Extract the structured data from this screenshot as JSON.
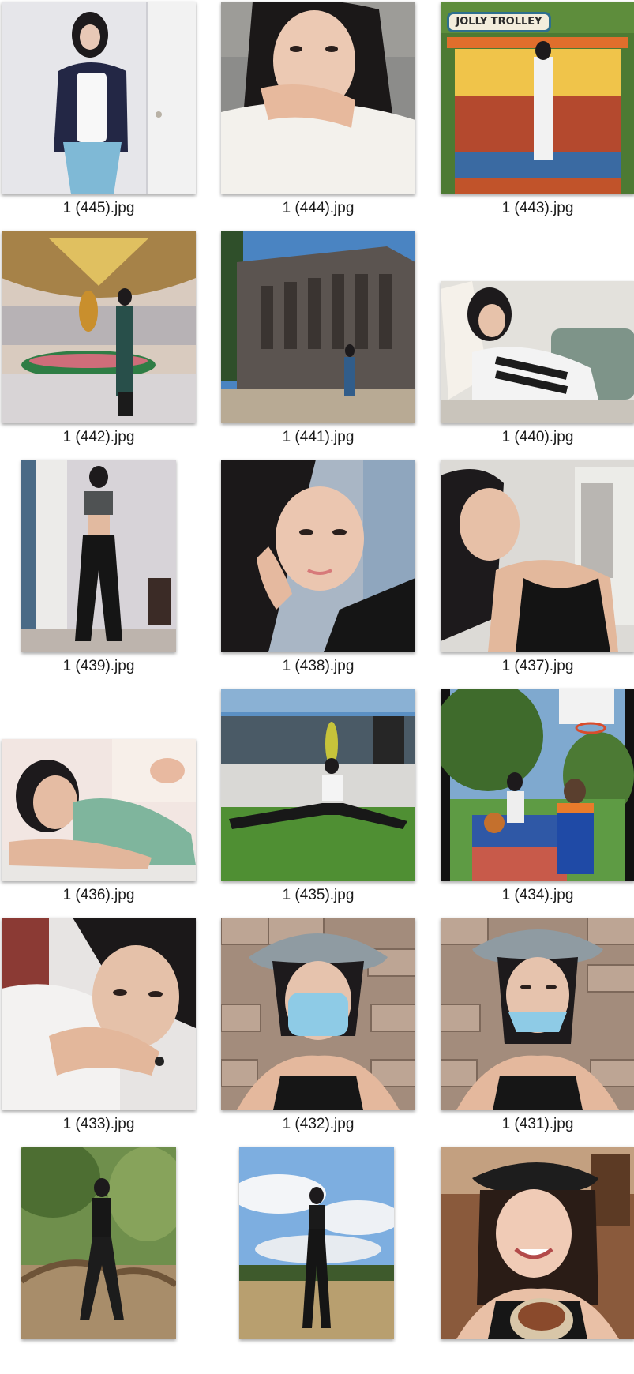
{
  "files": [
    {
      "name": "1 (445).jpg",
      "icon": "photo-thumbnail-icon"
    },
    {
      "name": "1 (444).jpg",
      "icon": "photo-thumbnail-icon"
    },
    {
      "name": "1 (443).jpg",
      "icon": "photo-thumbnail-icon",
      "sign_text": "JOLLY TROLLEY"
    },
    {
      "name": "1 (442).jpg",
      "icon": "photo-thumbnail-icon"
    },
    {
      "name": "1 (441).jpg",
      "icon": "photo-thumbnail-icon"
    },
    {
      "name": "1 (440).jpg",
      "icon": "photo-thumbnail-icon"
    },
    {
      "name": "1 (439).jpg",
      "icon": "photo-thumbnail-icon"
    },
    {
      "name": "1 (438).jpg",
      "icon": "photo-thumbnail-icon"
    },
    {
      "name": "1 (437).jpg",
      "icon": "photo-thumbnail-icon"
    },
    {
      "name": "1 (436).jpg",
      "icon": "photo-thumbnail-icon"
    },
    {
      "name": "1 (435).jpg",
      "icon": "photo-thumbnail-icon"
    },
    {
      "name": "1 (434).jpg",
      "icon": "photo-thumbnail-icon"
    },
    {
      "name": "1 (433).jpg",
      "icon": "photo-thumbnail-icon"
    },
    {
      "name": "1 (432).jpg",
      "icon": "photo-thumbnail-icon"
    },
    {
      "name": "1 (431).jpg",
      "icon": "photo-thumbnail-icon"
    },
    {
      "name": "",
      "icon": "photo-thumbnail-icon"
    },
    {
      "name": "",
      "icon": "photo-thumbnail-icon"
    },
    {
      "name": "",
      "icon": "photo-thumbnail-icon"
    }
  ]
}
